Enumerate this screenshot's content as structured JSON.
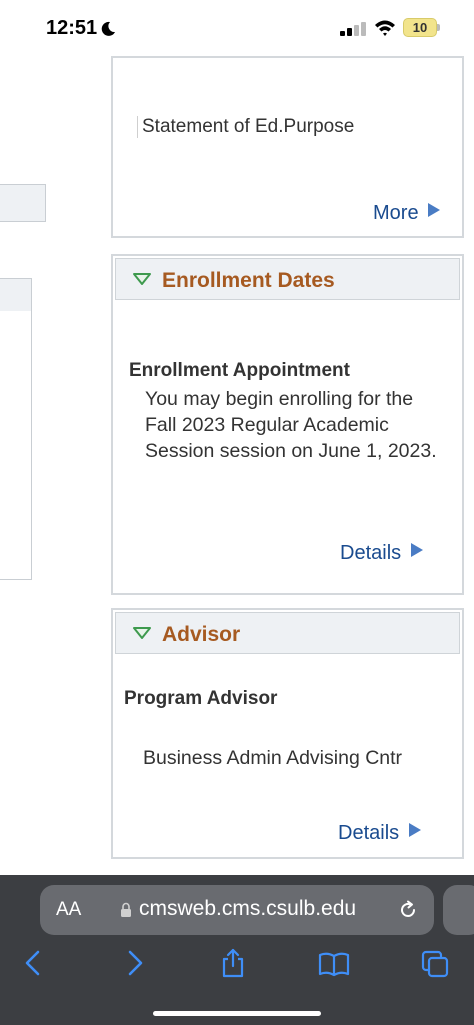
{
  "status_bar": {
    "time": "12:51",
    "battery": "10",
    "icons": [
      "moon-icon",
      "signal-icon",
      "wifi-icon",
      "battery-icon"
    ]
  },
  "panel_top": {
    "statement": "Statement of Ed.Purpose",
    "more_label": "More"
  },
  "enrollment": {
    "title": "Enrollment Dates",
    "appointment_label": "Enrollment Appointment",
    "appointment_text": "You may begin enrolling for the Fall 2023 Regular Academic Session session on June 1, 2023.",
    "details_label": "Details"
  },
  "advisor": {
    "title": "Advisor",
    "role": "Program Advisor",
    "name": "Business Admin Advising Cntr",
    "details_label": "Details"
  },
  "browser": {
    "aa_label": "AA",
    "url": "cmsweb.cms.csulb.edu"
  },
  "colors": {
    "panel_title": "#a65a21",
    "link": "#1a4b8f",
    "play_arrow": "#4a7cc4",
    "triangle_green": "#3e9a4e",
    "browser_bg": "#3c3e42",
    "url_field": "#696b70",
    "browser_icon": "#3f8ef7"
  }
}
